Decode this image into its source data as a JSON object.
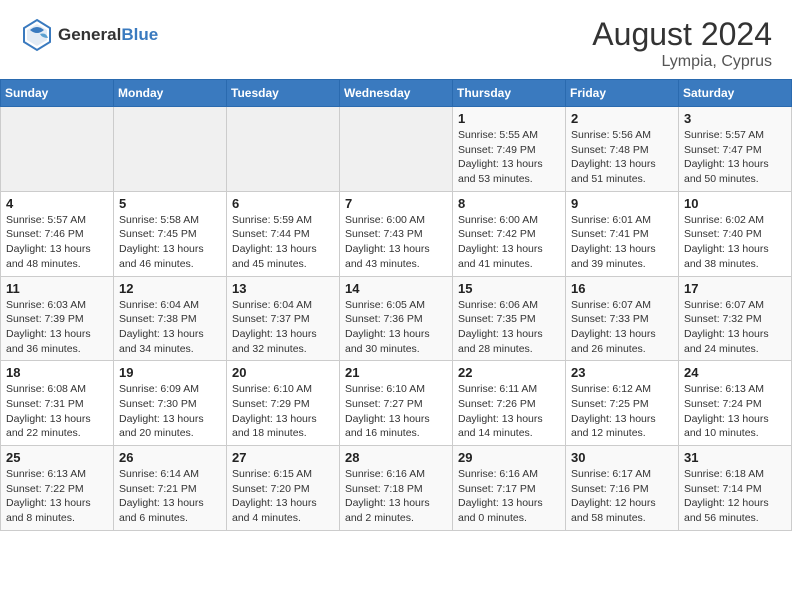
{
  "header": {
    "logo_line1": "General",
    "logo_line2": "Blue",
    "title": "August 2024",
    "subtitle": "Lympia, Cyprus"
  },
  "weekdays": [
    "Sunday",
    "Monday",
    "Tuesday",
    "Wednesday",
    "Thursday",
    "Friday",
    "Saturday"
  ],
  "weeks": [
    [
      {
        "day": "",
        "info": ""
      },
      {
        "day": "",
        "info": ""
      },
      {
        "day": "",
        "info": ""
      },
      {
        "day": "",
        "info": ""
      },
      {
        "day": "1",
        "info": "Sunrise: 5:55 AM\nSunset: 7:49 PM\nDaylight: 13 hours\nand 53 minutes."
      },
      {
        "day": "2",
        "info": "Sunrise: 5:56 AM\nSunset: 7:48 PM\nDaylight: 13 hours\nand 51 minutes."
      },
      {
        "day": "3",
        "info": "Sunrise: 5:57 AM\nSunset: 7:47 PM\nDaylight: 13 hours\nand 50 minutes."
      }
    ],
    [
      {
        "day": "4",
        "info": "Sunrise: 5:57 AM\nSunset: 7:46 PM\nDaylight: 13 hours\nand 48 minutes."
      },
      {
        "day": "5",
        "info": "Sunrise: 5:58 AM\nSunset: 7:45 PM\nDaylight: 13 hours\nand 46 minutes."
      },
      {
        "day": "6",
        "info": "Sunrise: 5:59 AM\nSunset: 7:44 PM\nDaylight: 13 hours\nand 45 minutes."
      },
      {
        "day": "7",
        "info": "Sunrise: 6:00 AM\nSunset: 7:43 PM\nDaylight: 13 hours\nand 43 minutes."
      },
      {
        "day": "8",
        "info": "Sunrise: 6:00 AM\nSunset: 7:42 PM\nDaylight: 13 hours\nand 41 minutes."
      },
      {
        "day": "9",
        "info": "Sunrise: 6:01 AM\nSunset: 7:41 PM\nDaylight: 13 hours\nand 39 minutes."
      },
      {
        "day": "10",
        "info": "Sunrise: 6:02 AM\nSunset: 7:40 PM\nDaylight: 13 hours\nand 38 minutes."
      }
    ],
    [
      {
        "day": "11",
        "info": "Sunrise: 6:03 AM\nSunset: 7:39 PM\nDaylight: 13 hours\nand 36 minutes."
      },
      {
        "day": "12",
        "info": "Sunrise: 6:04 AM\nSunset: 7:38 PM\nDaylight: 13 hours\nand 34 minutes."
      },
      {
        "day": "13",
        "info": "Sunrise: 6:04 AM\nSunset: 7:37 PM\nDaylight: 13 hours\nand 32 minutes."
      },
      {
        "day": "14",
        "info": "Sunrise: 6:05 AM\nSunset: 7:36 PM\nDaylight: 13 hours\nand 30 minutes."
      },
      {
        "day": "15",
        "info": "Sunrise: 6:06 AM\nSunset: 7:35 PM\nDaylight: 13 hours\nand 28 minutes."
      },
      {
        "day": "16",
        "info": "Sunrise: 6:07 AM\nSunset: 7:33 PM\nDaylight: 13 hours\nand 26 minutes."
      },
      {
        "day": "17",
        "info": "Sunrise: 6:07 AM\nSunset: 7:32 PM\nDaylight: 13 hours\nand 24 minutes."
      }
    ],
    [
      {
        "day": "18",
        "info": "Sunrise: 6:08 AM\nSunset: 7:31 PM\nDaylight: 13 hours\nand 22 minutes."
      },
      {
        "day": "19",
        "info": "Sunrise: 6:09 AM\nSunset: 7:30 PM\nDaylight: 13 hours\nand 20 minutes."
      },
      {
        "day": "20",
        "info": "Sunrise: 6:10 AM\nSunset: 7:29 PM\nDaylight: 13 hours\nand 18 minutes."
      },
      {
        "day": "21",
        "info": "Sunrise: 6:10 AM\nSunset: 7:27 PM\nDaylight: 13 hours\nand 16 minutes."
      },
      {
        "day": "22",
        "info": "Sunrise: 6:11 AM\nSunset: 7:26 PM\nDaylight: 13 hours\nand 14 minutes."
      },
      {
        "day": "23",
        "info": "Sunrise: 6:12 AM\nSunset: 7:25 PM\nDaylight: 13 hours\nand 12 minutes."
      },
      {
        "day": "24",
        "info": "Sunrise: 6:13 AM\nSunset: 7:24 PM\nDaylight: 13 hours\nand 10 minutes."
      }
    ],
    [
      {
        "day": "25",
        "info": "Sunrise: 6:13 AM\nSunset: 7:22 PM\nDaylight: 13 hours\nand 8 minutes."
      },
      {
        "day": "26",
        "info": "Sunrise: 6:14 AM\nSunset: 7:21 PM\nDaylight: 13 hours\nand 6 minutes."
      },
      {
        "day": "27",
        "info": "Sunrise: 6:15 AM\nSunset: 7:20 PM\nDaylight: 13 hours\nand 4 minutes."
      },
      {
        "day": "28",
        "info": "Sunrise: 6:16 AM\nSunset: 7:18 PM\nDaylight: 13 hours\nand 2 minutes."
      },
      {
        "day": "29",
        "info": "Sunrise: 6:16 AM\nSunset: 7:17 PM\nDaylight: 13 hours\nand 0 minutes."
      },
      {
        "day": "30",
        "info": "Sunrise: 6:17 AM\nSunset: 7:16 PM\nDaylight: 12 hours\nand 58 minutes."
      },
      {
        "day": "31",
        "info": "Sunrise: 6:18 AM\nSunset: 7:14 PM\nDaylight: 12 hours\nand 56 minutes."
      }
    ]
  ]
}
